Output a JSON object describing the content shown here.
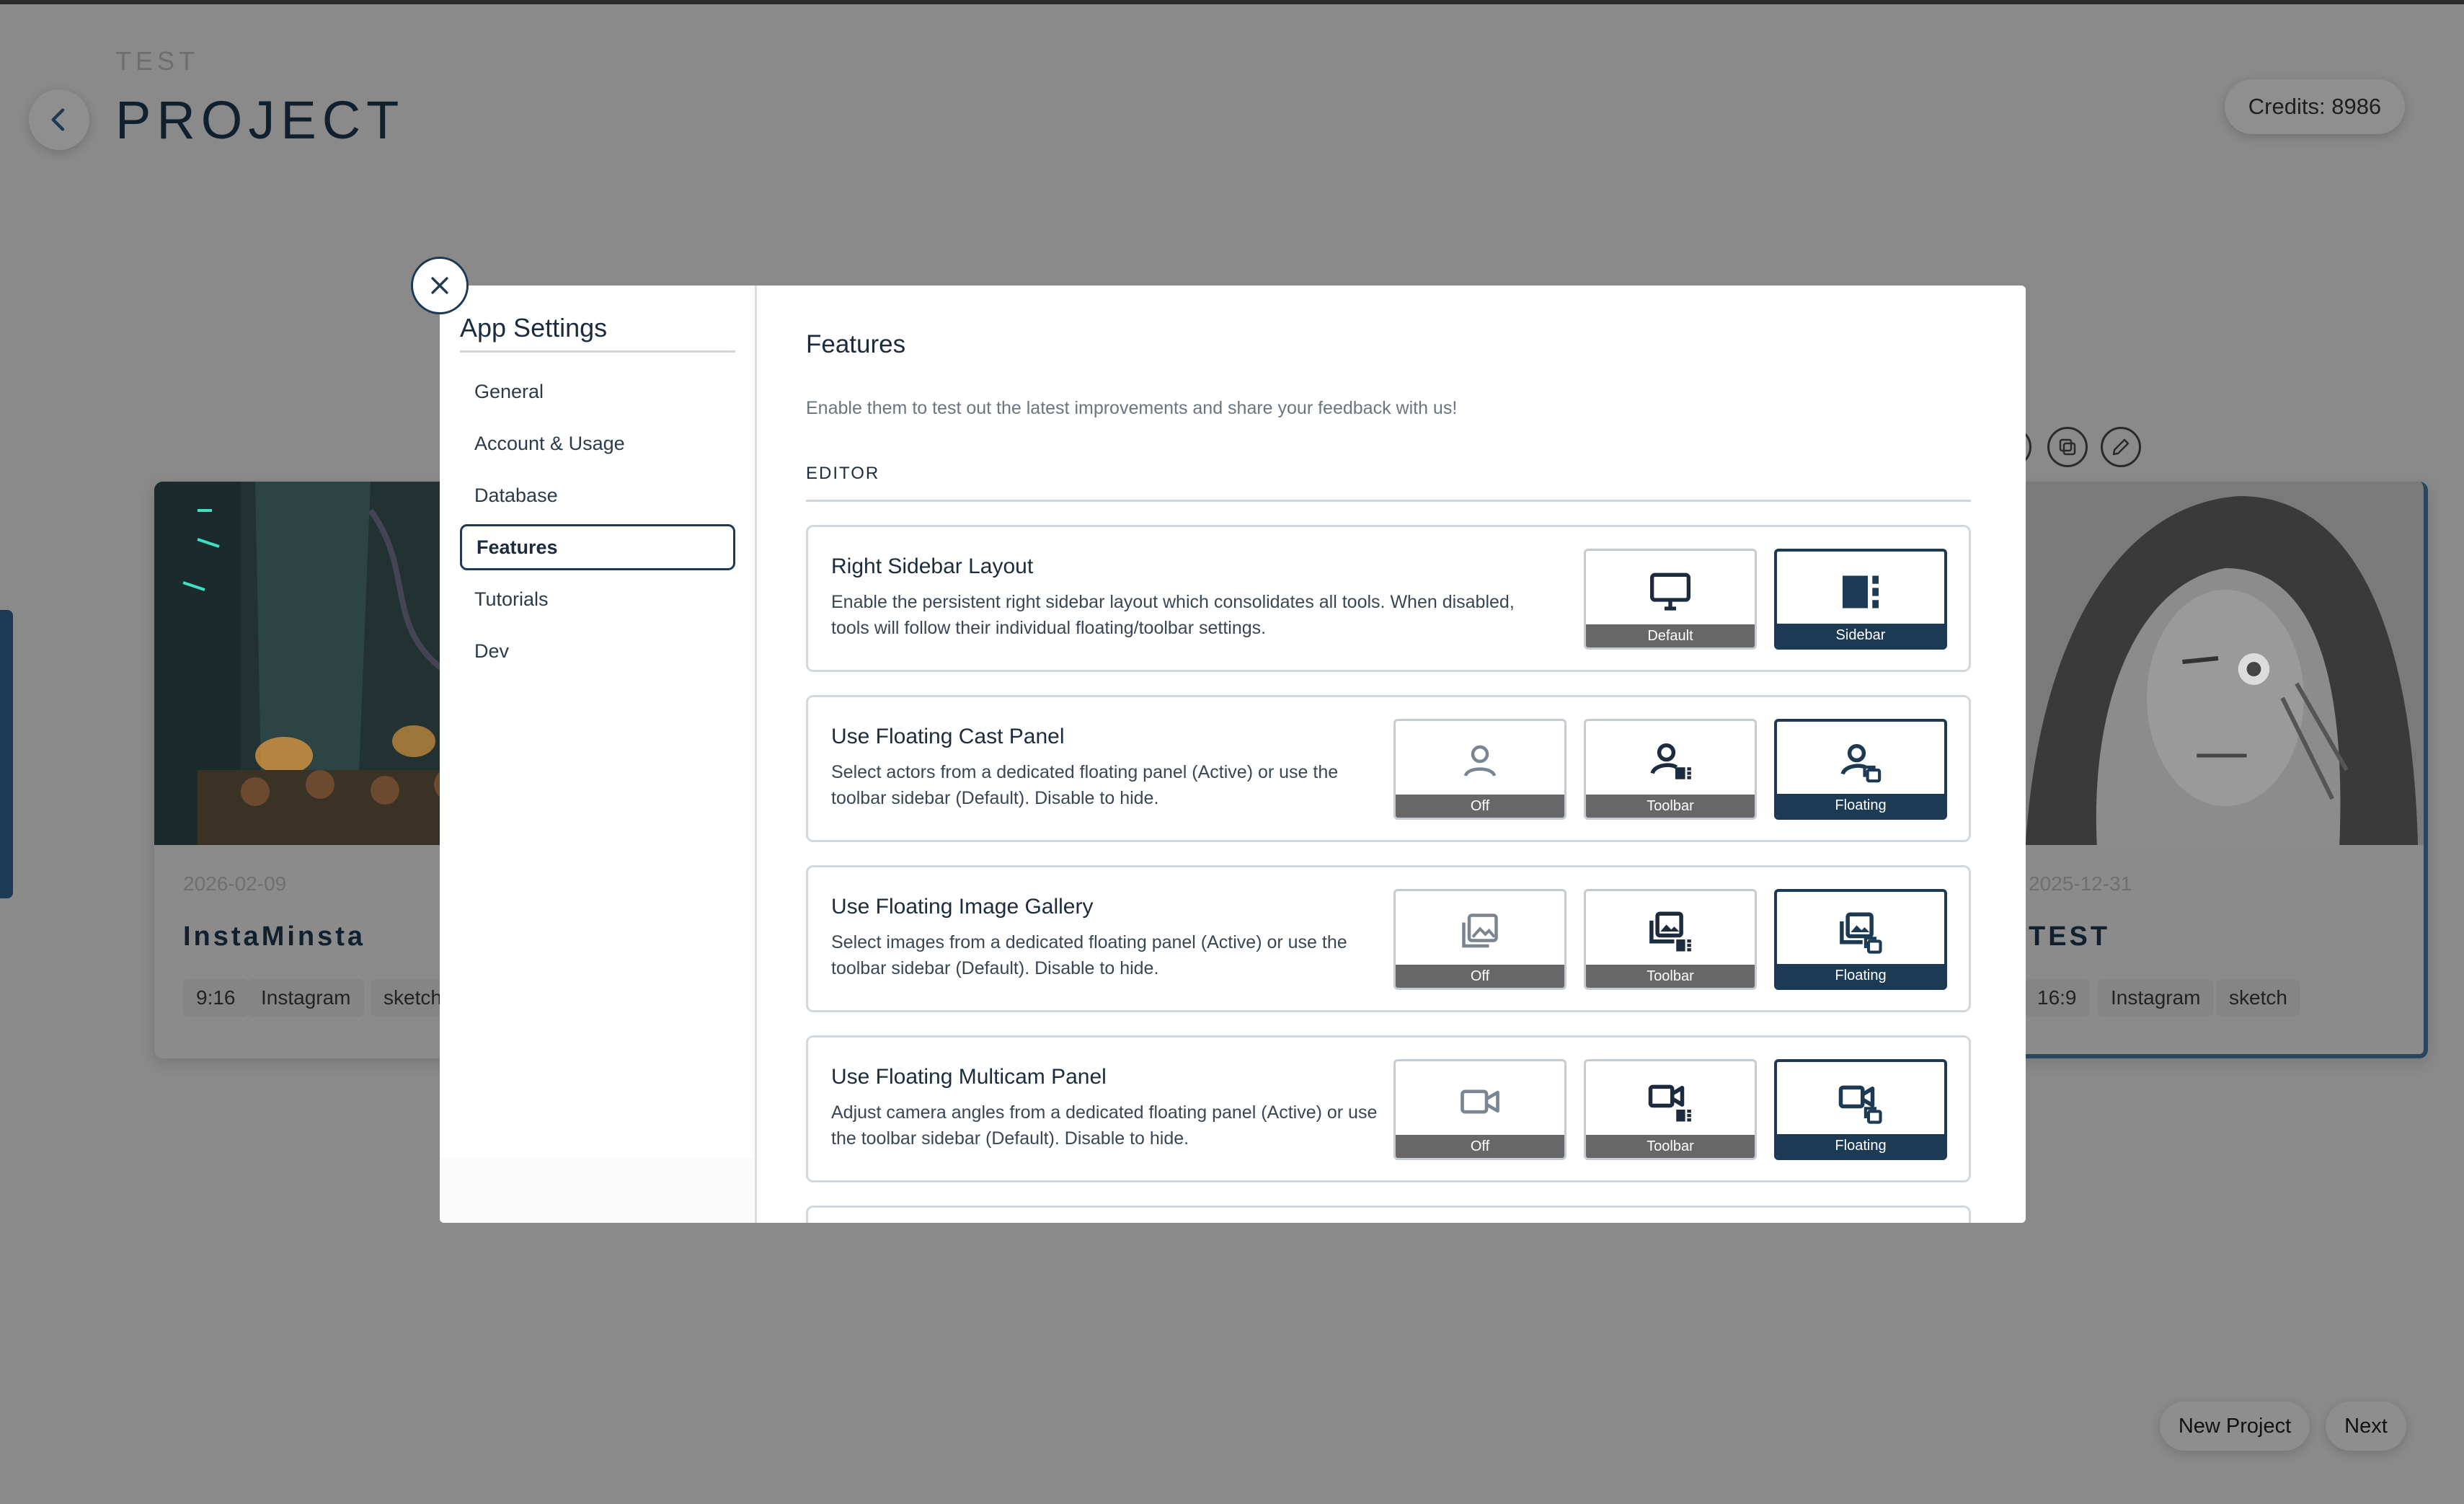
{
  "colors": {
    "accent": "#1d3a55",
    "overlay_bg": "#8a8a8a",
    "modal_bg": "#ffffff",
    "muted_label_bg": "#676767"
  },
  "background": {
    "project_supertitle": "TEST",
    "project_title": "PROJECT",
    "credits": "Credits: 8986",
    "cards": [
      {
        "date": "2026-02-09",
        "name": "InstaMinsta",
        "tags": [
          "9:16",
          "Instagram",
          "sketch"
        ]
      },
      {
        "date": "2025-12-31",
        "name": "TEST",
        "tags": [
          "16:9",
          "Instagram",
          "sketch"
        ]
      }
    ],
    "new_project_label": "New Project",
    "next_label": "Next"
  },
  "settings": {
    "title": "App Settings",
    "nav": [
      {
        "label": "General"
      },
      {
        "label": "Account & Usage"
      },
      {
        "label": "Database"
      },
      {
        "label": "Features",
        "active": true
      },
      {
        "label": "Tutorials"
      },
      {
        "label": "Dev"
      }
    ]
  },
  "features": {
    "title": "Features",
    "subtitle": "Enable them to test out the latest improvements and share your feedback with us!",
    "section": "EDITOR",
    "items": [
      {
        "title": "Right Sidebar Layout",
        "description": "Enable the persistent right sidebar layout which consolidates all tools. When disabled, tools will follow their individual floating/toolbar settings.",
        "options": [
          {
            "label": "Default",
            "icon": "monitor-icon"
          },
          {
            "label": "Sidebar",
            "icon": "sidebar-layout-icon",
            "selected": true
          }
        ]
      },
      {
        "title": "Use Floating Cast Panel",
        "description": "Select actors from a dedicated floating panel (Active) or use the toolbar sidebar (Default). Disable to hide.",
        "options": [
          {
            "label": "Off",
            "icon": "person-outline-icon"
          },
          {
            "label": "Toolbar",
            "icon": "person-toolbar-icon"
          },
          {
            "label": "Floating",
            "icon": "person-floating-icon",
            "selected": true
          }
        ]
      },
      {
        "title": "Use Floating Image Gallery",
        "description": "Select images from a dedicated floating panel (Active) or use the toolbar sidebar (Default). Disable to hide.",
        "options": [
          {
            "label": "Off",
            "icon": "gallery-outline-icon"
          },
          {
            "label": "Toolbar",
            "icon": "gallery-toolbar-icon"
          },
          {
            "label": "Floating",
            "icon": "gallery-floating-icon",
            "selected": true
          }
        ]
      },
      {
        "title": "Use Floating Multicam Panel",
        "description": "Adjust camera angles from a dedicated floating panel (Active) or use the toolbar sidebar (Default). Disable to hide.",
        "options": [
          {
            "label": "Off",
            "icon": "camera-outline-icon"
          },
          {
            "label": "Toolbar",
            "icon": "camera-toolbar-icon"
          },
          {
            "label": "Floating",
            "icon": "camera-floating-icon",
            "selected": true
          }
        ]
      }
    ]
  }
}
